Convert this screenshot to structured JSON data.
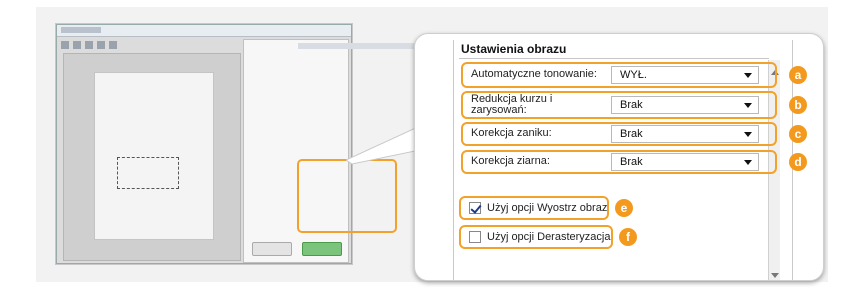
{
  "panel": {
    "title": "Ustawienia obrazu",
    "rows": [
      {
        "label": "Automatyczne tonowanie:",
        "value": "WYŁ.",
        "badge": "a"
      },
      {
        "label": "Redukcja kurzu i zarysowań:",
        "label_line1": "Redukcja kurzu i",
        "label_line2": "zarysowań:",
        "value": "Brak",
        "badge": "b"
      },
      {
        "label": "Korekcja zaniku:",
        "value": "Brak",
        "badge": "c"
      },
      {
        "label": "Korekcja ziarna:",
        "value": "Brak",
        "badge": "d"
      }
    ],
    "checkboxes": [
      {
        "label": "Użyj opcji Wyostrz obraz",
        "checked": true,
        "badge": "e"
      },
      {
        "label": "Użyj opcji Derasteryzacja",
        "checked": false,
        "badge": "f"
      }
    ]
  },
  "colors": {
    "highlight": "#f2a22a",
    "badge": "#f39a1e",
    "background": "#f2f2f2"
  }
}
